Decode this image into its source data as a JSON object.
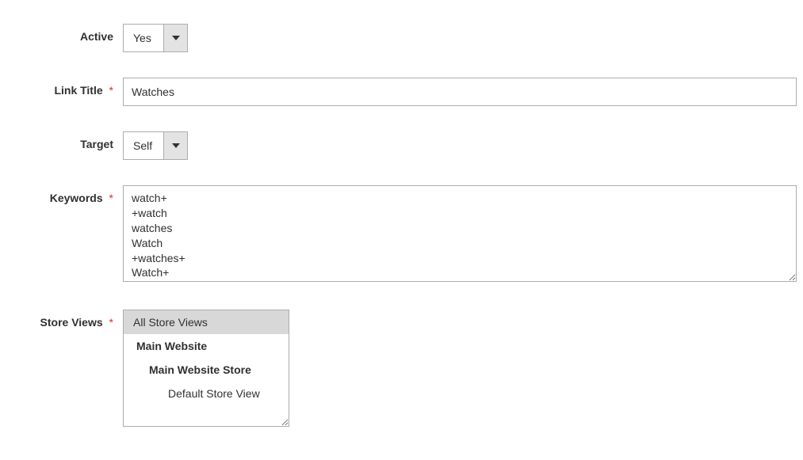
{
  "fields": {
    "active": {
      "label": "Active",
      "value": "Yes"
    },
    "link_title": {
      "label": "Link Title",
      "value": "Watches",
      "required": true
    },
    "target": {
      "label": "Target",
      "value": "Self"
    },
    "keywords": {
      "label": "Keywords",
      "value": "watch+\n+watch\nwatches\nWatch\n+watches+\nWatch+",
      "required": true
    },
    "store_views": {
      "label": "Store Views",
      "required": true,
      "options": [
        {
          "label": "All Store Views",
          "level": 0,
          "selected": true
        },
        {
          "label": "Main Website",
          "level": 1,
          "selected": false
        },
        {
          "label": "Main Website Store",
          "level": 2,
          "selected": false
        },
        {
          "label": "Default Store View",
          "level": 3,
          "selected": false
        }
      ]
    }
  },
  "asterisk": "*"
}
